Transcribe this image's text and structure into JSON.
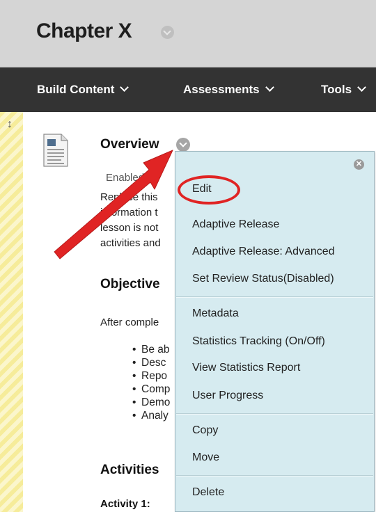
{
  "header": {
    "title": "Chapter X"
  },
  "nav": {
    "items": [
      {
        "label": "Build Content"
      },
      {
        "label": "Assessments"
      },
      {
        "label": "Tools"
      }
    ]
  },
  "content_item": {
    "title": "Overview",
    "status": "Enabled:",
    "description_lines": [
      "Replace this",
      "information t",
      "lesson is not",
      "activities and"
    ],
    "link_fragment": "e"
  },
  "objectives": {
    "heading": "Objective",
    "intro": "After comple",
    "bullets": [
      "Be ab",
      "Desc",
      "Repo",
      "Comp",
      "Demo",
      "Analy"
    ]
  },
  "activities": {
    "heading": "Activities",
    "first": "Activity 1:"
  },
  "context_menu": {
    "groups": [
      [
        "Edit",
        "Adaptive Release",
        "Adaptive Release: Advanced",
        "Set Review Status(Disabled)"
      ],
      [
        "Metadata",
        "Statistics Tracking (On/Off)",
        "View Statistics Report",
        "User Progress"
      ],
      [
        "Copy",
        "Move"
      ],
      [
        "Delete"
      ]
    ]
  },
  "colors": {
    "highlight": "#e02424",
    "menu_bg": "#d6ebf0",
    "nav_bg": "#333333",
    "stripe": "#f6ec9a"
  },
  "icons": {
    "close": "close-icon",
    "document": "document-icon",
    "drag": "drag-handle-icon"
  }
}
